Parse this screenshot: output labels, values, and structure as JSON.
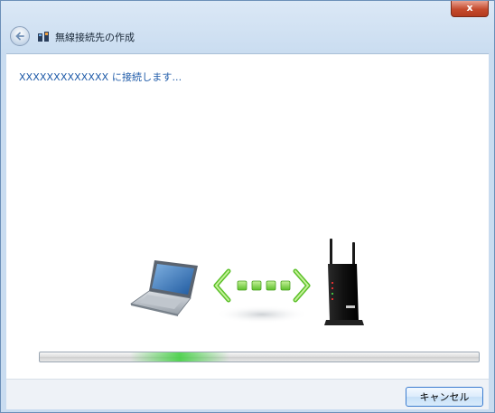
{
  "window": {
    "title": "無線接続先の作成",
    "close_symbol": "x"
  },
  "main": {
    "status_text": "XXXXXXXXXXXXX に接続します..."
  },
  "progress": {
    "state": "indeterminate"
  },
  "footer": {
    "cancel_label": "キャンセル"
  },
  "icons": {
    "back": "back-arrow-icon",
    "app": "wireless-network-icon",
    "laptop": "laptop-icon",
    "connection": "connection-arrows-icon",
    "router": "wireless-router-icon"
  },
  "colors": {
    "accent": "#1e5aa8",
    "progress_glow": "#3bd03b",
    "arrow_green": "#7fd64a",
    "close_red": "#c44a2d"
  }
}
